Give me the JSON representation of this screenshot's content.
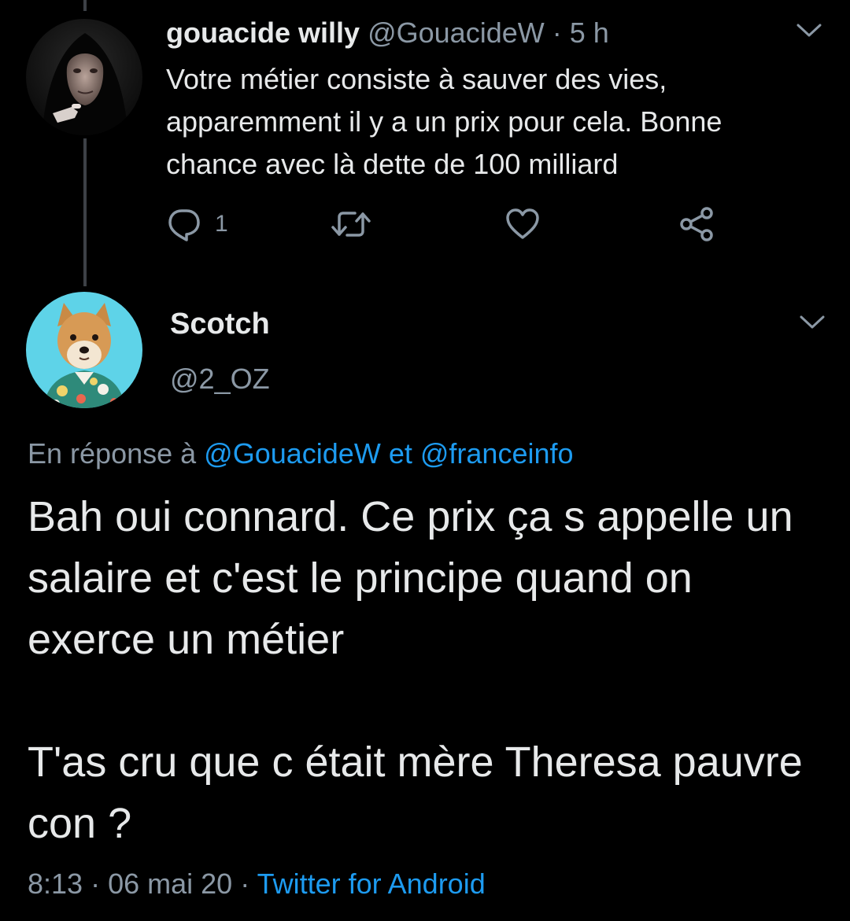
{
  "parent_tweet": {
    "display_name": "gouacide willy",
    "handle": "@GouacideW",
    "separator": "·",
    "time_ago": "5 h",
    "text": "Votre métier consiste à sauver des vies, apparemment il y a un prix pour cela. Bonne chance avec là dette de 100 milliard",
    "reply_count": "1",
    "icons": {
      "reply": "reply-icon",
      "retweet": "retweet-icon",
      "like": "heart-icon",
      "share": "share-icon",
      "menu": "chevron-down-icon"
    }
  },
  "main_tweet": {
    "display_name": "Scotch",
    "handle": "@2_OZ",
    "reply_prefix": "En réponse à",
    "reply_user_1": "@GouacideW",
    "reply_conjunction": "et",
    "reply_user_2": "@franceinfo",
    "paragraph_1": "Bah oui connard. Ce prix ça s appelle un salaire et c'est le principe quand on exerce un métier",
    "paragraph_2": "T'as cru que c était mère Theresa pauvre con ?",
    "time": "8:13",
    "separator": "·",
    "date": "06 mai 20",
    "source": "Twitter for Android"
  },
  "colors": {
    "background": "#000000",
    "text_primary": "#e7e9ea",
    "text_secondary": "#8b98a5",
    "link": "#1d9bf0",
    "thread_line": "#3d4146",
    "avatar_2_background": "#5ed3e8"
  }
}
